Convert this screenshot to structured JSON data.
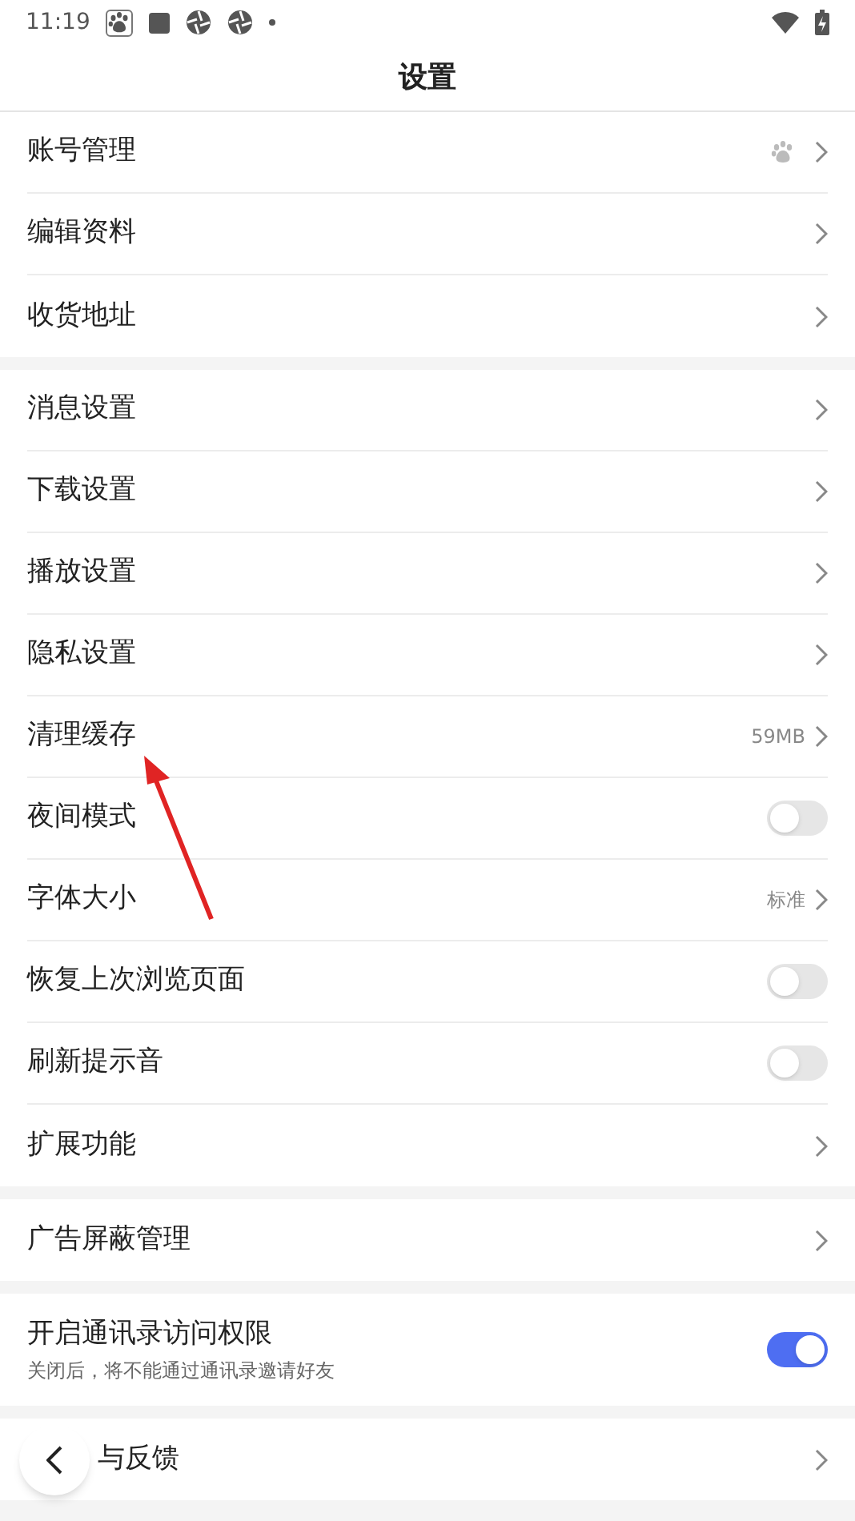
{
  "status_bar": {
    "time": "11:19"
  },
  "title": "设置",
  "groups": [
    {
      "rows": [
        {
          "label": "账号管理",
          "kind": "icon"
        },
        {
          "label": "编辑资料",
          "kind": "link"
        },
        {
          "label": "收货地址",
          "kind": "link"
        }
      ]
    },
    {
      "rows": [
        {
          "label": "消息设置",
          "kind": "link"
        },
        {
          "label": "下载设置",
          "kind": "link"
        },
        {
          "label": "播放设置",
          "kind": "link"
        },
        {
          "label": "隐私设置",
          "kind": "link"
        },
        {
          "label": "清理缓存",
          "kind": "value",
          "value": "59MB"
        },
        {
          "label": "夜间模式",
          "kind": "toggle",
          "on": false
        },
        {
          "label": "字体大小",
          "kind": "value",
          "value": "标准"
        },
        {
          "label": "恢复上次浏览页面",
          "kind": "toggle",
          "on": false
        },
        {
          "label": "刷新提示音",
          "kind": "toggle",
          "on": false
        },
        {
          "label": "扩展功能",
          "kind": "link"
        }
      ]
    },
    {
      "rows": [
        {
          "label": "广告屏蔽管理",
          "kind": "link"
        }
      ]
    },
    {
      "rows": [
        {
          "label": "开启通讯录访问权限",
          "kind": "toggle",
          "on": true,
          "subtitle": "关闭后，将不能通过通讯录邀请好友"
        }
      ]
    },
    {
      "rows": [
        {
          "label": "与反馈",
          "kind": "link"
        }
      ]
    }
  ]
}
